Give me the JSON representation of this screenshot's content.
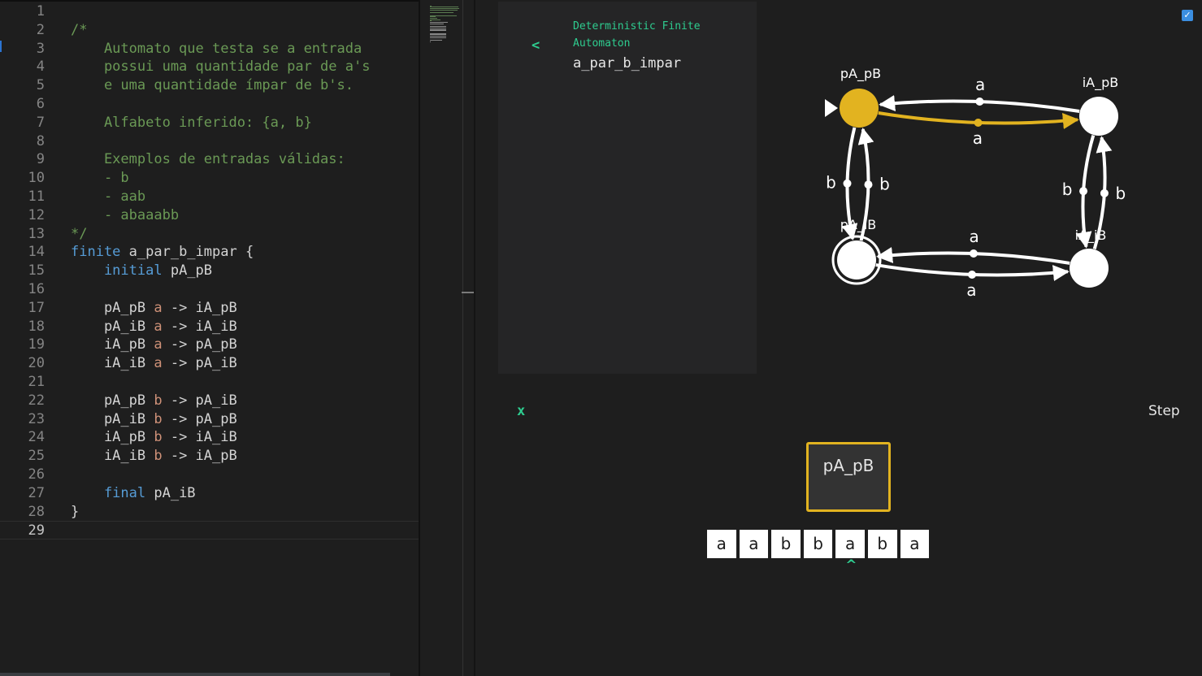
{
  "editor": {
    "lines": [
      {
        "num": "1",
        "tokens": []
      },
      {
        "num": "2",
        "tokens": [
          {
            "t": "/*",
            "c": "comment"
          }
        ]
      },
      {
        "num": "3",
        "tokens": [
          {
            "t": "    Automato que testa se a entrada",
            "c": "comment"
          }
        ]
      },
      {
        "num": "4",
        "tokens": [
          {
            "t": "    possui uma quantidade par de a's",
            "c": "comment"
          }
        ]
      },
      {
        "num": "5",
        "tokens": [
          {
            "t": "    e uma quantidade ímpar de b's.",
            "c": "comment"
          }
        ]
      },
      {
        "num": "6",
        "tokens": []
      },
      {
        "num": "7",
        "tokens": [
          {
            "t": "    Alfabeto inferido: {a, b}",
            "c": "comment"
          }
        ]
      },
      {
        "num": "8",
        "tokens": []
      },
      {
        "num": "9",
        "tokens": [
          {
            "t": "    Exemplos de entradas válidas:",
            "c": "comment"
          }
        ]
      },
      {
        "num": "10",
        "tokens": [
          {
            "t": "    - b",
            "c": "comment"
          }
        ]
      },
      {
        "num": "11",
        "tokens": [
          {
            "t": "    - aab",
            "c": "comment"
          }
        ]
      },
      {
        "num": "12",
        "tokens": [
          {
            "t": "    - abaaabb",
            "c": "comment"
          }
        ]
      },
      {
        "num": "13",
        "tokens": [
          {
            "t": "*/",
            "c": "comment"
          }
        ]
      },
      {
        "num": "14",
        "tokens": [
          {
            "t": "finite",
            "c": "keyword"
          },
          {
            "t": " a_par_b_impar {",
            "c": "default"
          }
        ]
      },
      {
        "num": "15",
        "tokens": [
          {
            "t": "    initial",
            "c": "keyword"
          },
          {
            "t": " pA_pB",
            "c": "default"
          }
        ]
      },
      {
        "num": "16",
        "tokens": []
      },
      {
        "num": "17",
        "tokens": [
          {
            "t": "    pA_pB ",
            "c": "default"
          },
          {
            "t": "a",
            "c": "symbol"
          },
          {
            "t": " -> iA_pB",
            "c": "default"
          }
        ]
      },
      {
        "num": "18",
        "tokens": [
          {
            "t": "    pA_iB ",
            "c": "default"
          },
          {
            "t": "a",
            "c": "symbol"
          },
          {
            "t": " -> iA_iB",
            "c": "default"
          }
        ]
      },
      {
        "num": "19",
        "tokens": [
          {
            "t": "    iA_pB ",
            "c": "default"
          },
          {
            "t": "a",
            "c": "symbol"
          },
          {
            "t": " -> pA_pB",
            "c": "default"
          }
        ]
      },
      {
        "num": "20",
        "tokens": [
          {
            "t": "    iA_iB ",
            "c": "default"
          },
          {
            "t": "a",
            "c": "symbol"
          },
          {
            "t": " -> pA_iB",
            "c": "default"
          }
        ]
      },
      {
        "num": "21",
        "tokens": []
      },
      {
        "num": "22",
        "tokens": [
          {
            "t": "    pA_pB ",
            "c": "default"
          },
          {
            "t": "b",
            "c": "symbol"
          },
          {
            "t": " -> pA_iB",
            "c": "default"
          }
        ]
      },
      {
        "num": "23",
        "tokens": [
          {
            "t": "    pA_iB ",
            "c": "default"
          },
          {
            "t": "b",
            "c": "symbol"
          },
          {
            "t": " -> pA_pB",
            "c": "default"
          }
        ]
      },
      {
        "num": "24",
        "tokens": [
          {
            "t": "    iA_pB ",
            "c": "default"
          },
          {
            "t": "b",
            "c": "symbol"
          },
          {
            "t": " -> iA_iB",
            "c": "default"
          }
        ]
      },
      {
        "num": "25",
        "tokens": [
          {
            "t": "    iA_iB ",
            "c": "default"
          },
          {
            "t": "b",
            "c": "symbol"
          },
          {
            "t": " -> iA_pB",
            "c": "default"
          }
        ]
      },
      {
        "num": "26",
        "tokens": []
      },
      {
        "num": "27",
        "tokens": [
          {
            "t": "    final",
            "c": "keyword"
          },
          {
            "t": " pA_iB",
            "c": "default"
          }
        ]
      },
      {
        "num": "28",
        "tokens": [
          {
            "t": "}",
            "c": "default"
          }
        ]
      },
      {
        "num": "29",
        "tokens": []
      }
    ],
    "current_line": "29",
    "colors": {
      "comment": "#6a9955",
      "keyword": "#569cd6",
      "symbol": "#ce9178",
      "default": "#d4d4d4"
    }
  },
  "panel": {
    "back_label": "<",
    "type_label": "Deterministic Finite Automaton",
    "name": "a_par_b_impar",
    "checkbox_checked": true,
    "checkbox_glyph": "✓"
  },
  "automaton": {
    "states": [
      {
        "id": "pA_pB",
        "label": "pA_pB",
        "initial": true,
        "final": false,
        "active": true
      },
      {
        "id": "iA_pB",
        "label": "iA_pB",
        "initial": false,
        "final": false,
        "active": false
      },
      {
        "id": "pA_iB",
        "label": "pA_iB",
        "initial": false,
        "final": true,
        "active": false
      },
      {
        "id": "iA_iB",
        "label": "iA_iB",
        "initial": false,
        "final": false,
        "active": false
      }
    ],
    "transitions": [
      {
        "from": "pA_pB",
        "to": "iA_pB",
        "symbol": "a",
        "active": true
      },
      {
        "from": "iA_pB",
        "to": "pA_pB",
        "symbol": "a",
        "active": false
      },
      {
        "from": "pA_iB",
        "to": "iA_iB",
        "symbol": "a",
        "active": false
      },
      {
        "from": "iA_iB",
        "to": "pA_iB",
        "symbol": "a",
        "active": false
      },
      {
        "from": "pA_pB",
        "to": "pA_iB",
        "symbol": "b",
        "active": false
      },
      {
        "from": "pA_iB",
        "to": "pA_pB",
        "symbol": "b",
        "active": false
      },
      {
        "from": "iA_pB",
        "to": "iA_iB",
        "symbol": "b",
        "active": false
      },
      {
        "from": "iA_iB",
        "to": "iA_pB",
        "symbol": "b",
        "active": false
      }
    ],
    "active_color": "#e2b320"
  },
  "simulation": {
    "close_label": "x",
    "step_label": "Step",
    "current_state": "pA_pB",
    "tape": [
      "a",
      "a",
      "b",
      "b",
      "a",
      "b",
      "a"
    ],
    "head_index": 4,
    "head_glyph": "^"
  }
}
